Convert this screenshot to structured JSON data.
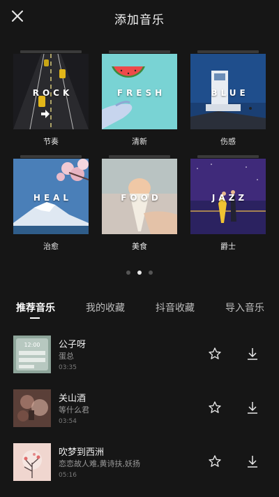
{
  "header": {
    "title": "添加音乐",
    "close_icon": "close-icon"
  },
  "categories": [
    {
      "cover_text": "ROCK",
      "label": "节奏"
    },
    {
      "cover_text": "FRESH",
      "label": "清新"
    },
    {
      "cover_text": "BLUE",
      "label": "伤感"
    },
    {
      "cover_text": "HEAL",
      "label": "治愈"
    },
    {
      "cover_text": "FOOD",
      "label": "美食"
    },
    {
      "cover_text": "JAZZ",
      "label": "爵士"
    }
  ],
  "pager": {
    "count": 3,
    "active": 2
  },
  "tabs": [
    {
      "label": "推荐音乐",
      "active": true
    },
    {
      "label": "我的收藏",
      "active": false
    },
    {
      "label": "抖音收藏",
      "active": false
    },
    {
      "label": "导入音乐",
      "active": false
    }
  ],
  "songs": [
    {
      "title": "公子呀",
      "artist": "蛋总",
      "duration": "03:35",
      "thumb_text": "12:00"
    },
    {
      "title": "关山酒",
      "artist": "等什么君",
      "duration": "03:54"
    },
    {
      "title": "吹梦到西洲",
      "artist": "恋恋故人难,黄诗扶,妖扬",
      "duration": "05:16"
    }
  ],
  "icons": {
    "favorite": "star-icon",
    "download": "download-icon"
  },
  "colors": {
    "background": "#161616",
    "active_tab": "#ffffff",
    "inactive_tab": "#bdbdbd"
  }
}
